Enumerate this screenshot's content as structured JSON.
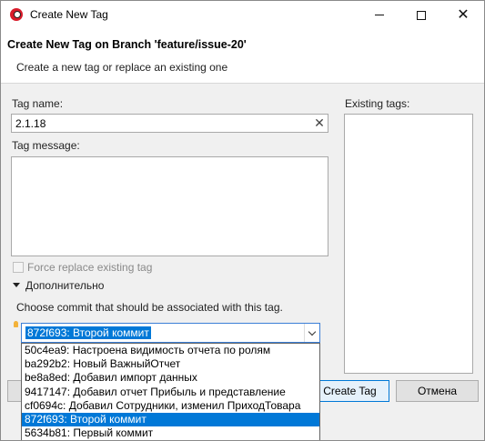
{
  "window": {
    "title": "Create New Tag"
  },
  "header": {
    "title": "Create New Tag on Branch 'feature/issue-20'",
    "description": "Create a new tag or replace an existing one"
  },
  "form": {
    "tag_name_label": "Tag name:",
    "tag_name_value": "2.1.18",
    "tag_message_label": "Tag message:",
    "tag_message_value": "",
    "existing_tags_label": "Existing tags:",
    "force_replace_label": "Force replace existing tag",
    "force_replace_checked": false,
    "advanced_section_label": "Дополнительно",
    "commit_prompt": "Choose commit that should be associated with this tag.",
    "commit_selected": "872f693: Второй коммит"
  },
  "dropdown": {
    "items": [
      "50c4ea9: Настроена видимость отчета по ролям",
      "ba292b2: Новый ВажныйОтчет",
      "be8a8ed: Добавил импорт данных",
      "9417147: Добавил отчет Прибыль и представление",
      "cf0694c: Добавил Сотрудники, изменил ПриходТовара",
      "872f693: Второй коммит",
      "5634b81: Первый коммит"
    ],
    "selected_index": 5
  },
  "buttons": {
    "create": "Create Tag",
    "cancel": "Отмена"
  },
  "icons": {
    "app": "eclipse-egit-icon",
    "clear": "clear-x-icon",
    "hint": "lightbulb-icon",
    "expand": "triangle-down-icon",
    "combo_arrow": "chevron-down-icon"
  }
}
